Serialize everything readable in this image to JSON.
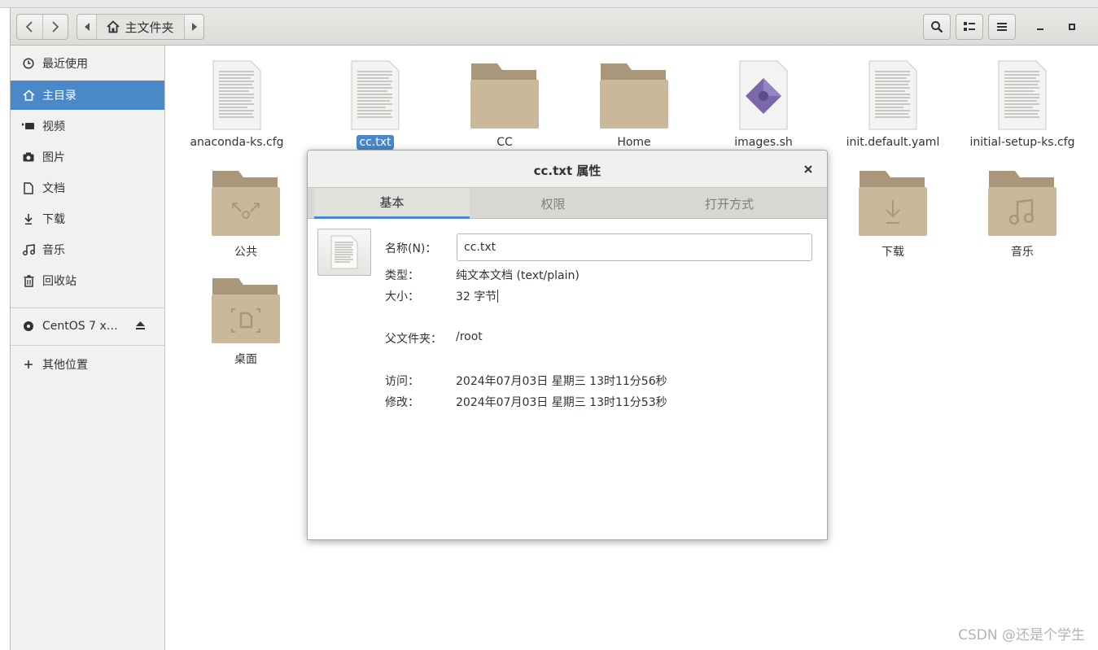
{
  "path_bar": {
    "location": "主文件夹"
  },
  "sidebar": {
    "items": [
      {
        "label": "最近使用",
        "icon": "clock-icon"
      },
      {
        "label": "主目录",
        "icon": "home-icon",
        "active": true
      },
      {
        "label": "视频",
        "icon": "video-icon"
      },
      {
        "label": "图片",
        "icon": "camera-icon"
      },
      {
        "label": "文档",
        "icon": "document-icon"
      },
      {
        "label": "下载",
        "icon": "download-icon"
      },
      {
        "label": "音乐",
        "icon": "music-icon"
      },
      {
        "label": "回收站",
        "icon": "trash-icon"
      }
    ],
    "device": {
      "label": "CentOS 7 x…",
      "icon": "disc-icon",
      "eject_icon": "eject-icon"
    },
    "other": {
      "label": "其他位置",
      "icon": "plus-icon"
    }
  },
  "files": [
    {
      "name": "anaconda-ks.cfg",
      "type": "text"
    },
    {
      "name": "cc.txt",
      "type": "text",
      "selected": true
    },
    {
      "name": "CC",
      "type": "folder"
    },
    {
      "name": "Home",
      "type": "folder"
    },
    {
      "name": "images.sh",
      "type": "script"
    },
    {
      "name": "init.default.yaml",
      "type": "text"
    },
    {
      "name": "initial-setup-ks.cfg",
      "type": "text"
    },
    {
      "name": "公共",
      "type": "folder-share"
    },
    {
      "name": "下载",
      "type": "folder-download"
    },
    {
      "name": "音乐",
      "type": "folder-music"
    },
    {
      "name": "桌面",
      "type": "folder-desktop"
    }
  ],
  "dialog": {
    "title": "cc.txt 属性",
    "tabs": [
      "基本",
      "权限",
      "打开方式"
    ],
    "active_tab": 0,
    "name_label": "名称(N)：",
    "name_value": "cc.txt",
    "type_label": "类型：",
    "type_value": "纯文本文档 (text/plain)",
    "size_label": "大小：",
    "size_value": "32 字节",
    "parent_label": "父文件夹：",
    "parent_value": "/root",
    "access_label": "访问：",
    "access_value": "2024年07月03日 星期三 13时11分56秒",
    "modified_label": "修改：",
    "modified_value": "2024年07月03日 星期三 13时11分53秒"
  },
  "colors": {
    "accent": "#4a88c8",
    "folder": "#c9b99a",
    "folder_tab": "#a8977a"
  },
  "watermark": "CSDN @还是个学生"
}
